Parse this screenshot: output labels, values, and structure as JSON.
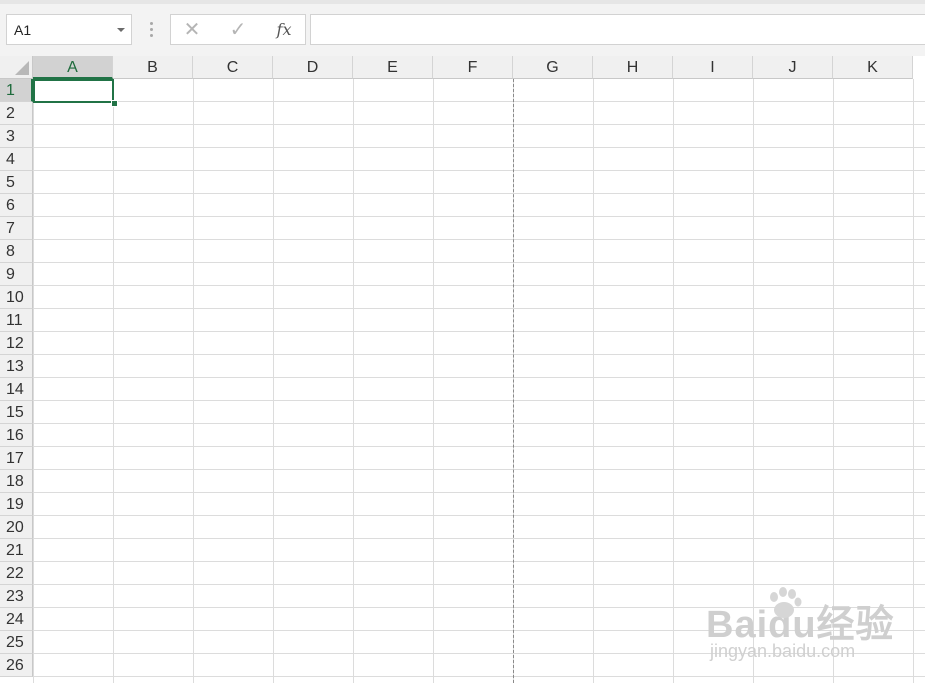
{
  "formula_bar": {
    "name_box_value": "A1",
    "cancel_icon": "cross-icon",
    "enter_icon": "check-icon",
    "insert_function_label": "fx",
    "formula_value": ""
  },
  "sheet": {
    "active_cell": "A1",
    "columns": [
      "A",
      "B",
      "C",
      "D",
      "E",
      "F",
      "G",
      "H",
      "I",
      "J",
      "K"
    ],
    "rows": [
      "1",
      "2",
      "3",
      "4",
      "5",
      "6",
      "7",
      "8",
      "9",
      "10",
      "11",
      "12",
      "13",
      "14",
      "15",
      "16",
      "17",
      "18",
      "19",
      "20",
      "21",
      "22",
      "23",
      "24",
      "25",
      "26"
    ],
    "page_break_after_column": "F",
    "accent_color": "#217346"
  },
  "watermark": {
    "brand_text": "Baidu经验",
    "url_text": "jingyan.baidu.com"
  }
}
